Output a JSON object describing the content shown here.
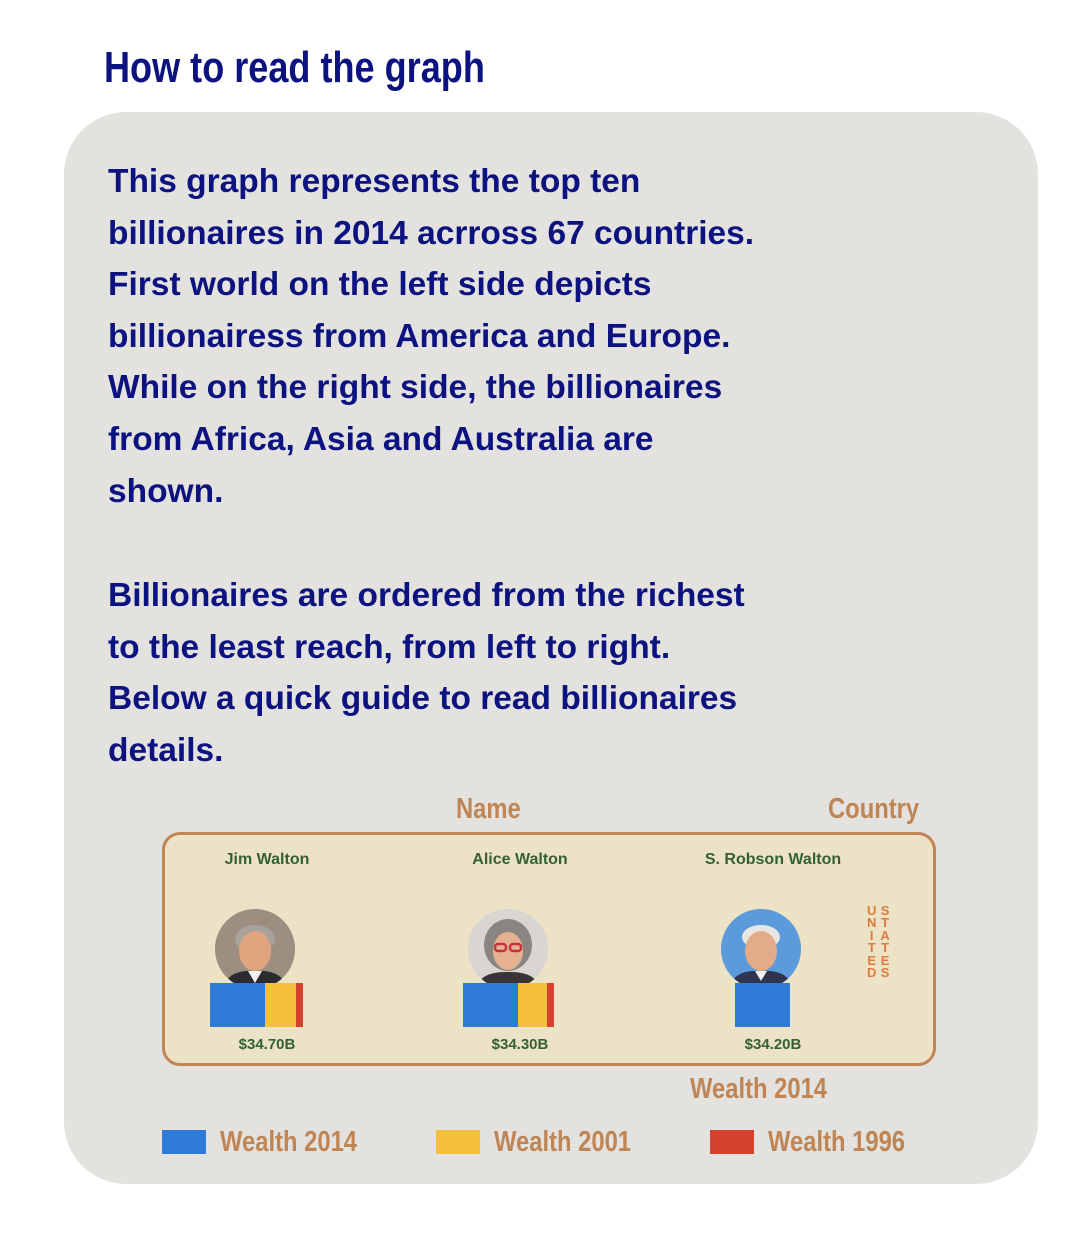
{
  "heading": "How to read the graph",
  "description": {
    "paragraph_1": "This graph represents the top ten\nbillionaires in 2014 acrross 67 countries.\nFirst world on the left side depicts\nbillionairess from America and Europe.\nWhile on the right side, the billionaires\nfrom Africa, Asia and Australia are\nshown.",
    "paragraph_2": "Billionaires are ordered from the richest\nto the least reach, from left to right.\nBelow a quick guide to read billionaires\ndetails."
  },
  "annotations": {
    "name": "Name",
    "country": "Country",
    "wealth": "Wealth 2014"
  },
  "example": {
    "country_letters": [
      "U",
      "N",
      "I",
      "T",
      "E",
      "D",
      "S",
      "T",
      "A",
      "T",
      "E",
      "S"
    ],
    "people": [
      {
        "name": "Jim Walton",
        "wealth_label": "$34.70B",
        "wealth_2014": 34.7,
        "has_2001": true,
        "has_1996": true
      },
      {
        "name": "Alice Walton",
        "wealth_label": "$34.30B",
        "wealth_2014": 34.3,
        "has_2001": true,
        "has_1996": true
      },
      {
        "name": "S. Robson Walton",
        "wealth_label": "$34.20B",
        "wealth_2014": 34.2,
        "has_2001": false,
        "has_1996": false
      }
    ]
  },
  "legend": [
    {
      "label": "Wealth 2014",
      "color": "#2f7bd8"
    },
    {
      "label": "Wealth 2001",
      "color": "#f5c13c"
    },
    {
      "label": "Wealth 1996",
      "color": "#d6412d"
    }
  ],
  "colors": {
    "heading_text": "#0c1280",
    "panel": "#e3e2de",
    "annotation_text": "#bf8554",
    "card_background": "#ece2c6",
    "name_text": "#346134",
    "country_text": "#df7b40"
  }
}
